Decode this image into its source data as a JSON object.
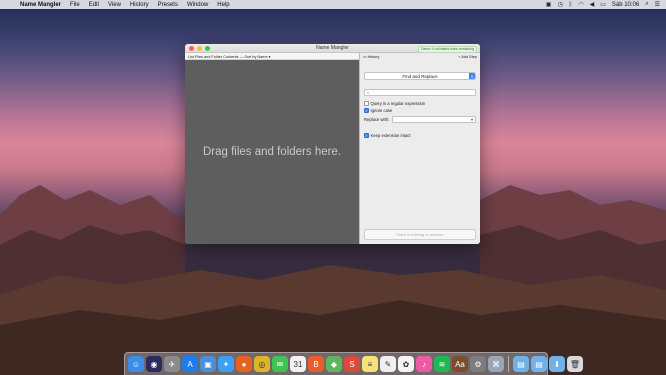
{
  "menubar": {
    "app_name": "Name Mangler",
    "items": [
      "File",
      "Edit",
      "View",
      "History",
      "Presets",
      "Window",
      "Help"
    ],
    "clock": "Sáb 10:06"
  },
  "window": {
    "title": "Name Mangler",
    "demo_badge": "Demo: 6 unlimited uses remaining",
    "left_toolbar": "List Files and Folder Contents — Sort by Name ▾",
    "drop_placeholder": "Drag files and folders here.",
    "history_label": "History",
    "add_step_label": "+ Add Step",
    "step_type": "Find and Replace",
    "find_placeholder": "",
    "regex_label": "Query is a regular expression",
    "regex_checked": false,
    "ignore_case_label": "Ignore case",
    "ignore_case_checked": true,
    "replace_label": "Replace with:",
    "keep_extension_label": "Keep extension intact",
    "keep_extension_checked": true,
    "rename_button": "There is nothing to rename."
  },
  "dock": {
    "icons": [
      {
        "name": "finder-icon",
        "color": "#3a8ee6",
        "glyph": "☺"
      },
      {
        "name": "siri-icon",
        "color": "#2b2b5e",
        "glyph": "◉"
      },
      {
        "name": "launchpad-icon",
        "color": "#8b8b8b",
        "glyph": "✈"
      },
      {
        "name": "app-store-icon",
        "color": "#1d7cf2",
        "glyph": "A"
      },
      {
        "name": "preview-icon",
        "color": "#4a90d9",
        "glyph": "▣"
      },
      {
        "name": "safari-icon",
        "color": "#3aa0f5",
        "glyph": "✦"
      },
      {
        "name": "firefox-icon",
        "color": "#e8621f",
        "glyph": "●"
      },
      {
        "name": "chrome-icon",
        "color": "#dfb42a",
        "glyph": "◎"
      },
      {
        "name": "messages-icon",
        "color": "#41c354",
        "glyph": "✉"
      },
      {
        "name": "calendar-icon",
        "color": "#f2f2f2",
        "glyph": "31"
      },
      {
        "name": "books-icon",
        "color": "#e85d2a",
        "glyph": "B"
      },
      {
        "name": "maps-icon",
        "color": "#5fb45f",
        "glyph": "◆"
      },
      {
        "name": "scrivener-icon",
        "color": "#d94a3a",
        "glyph": "S"
      },
      {
        "name": "notes-icon",
        "color": "#f7e27a",
        "glyph": "≡"
      },
      {
        "name": "textedit-icon",
        "color": "#f0f0f0",
        "glyph": "✎"
      },
      {
        "name": "photos-icon",
        "color": "#f5f5f5",
        "glyph": "✿"
      },
      {
        "name": "itunes-icon",
        "color": "#ef5aa6",
        "glyph": "♪"
      },
      {
        "name": "spotify-icon",
        "color": "#1db954",
        "glyph": "≋"
      },
      {
        "name": "dictionary-icon",
        "color": "#7a4d2e",
        "glyph": "Aa"
      },
      {
        "name": "system-preferences-icon",
        "color": "#7d7d7d",
        "glyph": "⚙"
      },
      {
        "name": "name-mangler-icon",
        "color": "#9aa6b8",
        "glyph": "⌘"
      }
    ],
    "folders": [
      {
        "name": "applications-folder-icon",
        "color": "#6fb2e8",
        "glyph": "▤"
      },
      {
        "name": "documents-folder-icon",
        "color": "#6fb2e8",
        "glyph": "▤"
      },
      {
        "name": "downloads-folder-icon",
        "color": "#6fb2e8",
        "glyph": "⬇"
      }
    ],
    "trash": {
      "name": "trash-icon",
      "color": "#d9d9de",
      "glyph": "🗑"
    }
  }
}
